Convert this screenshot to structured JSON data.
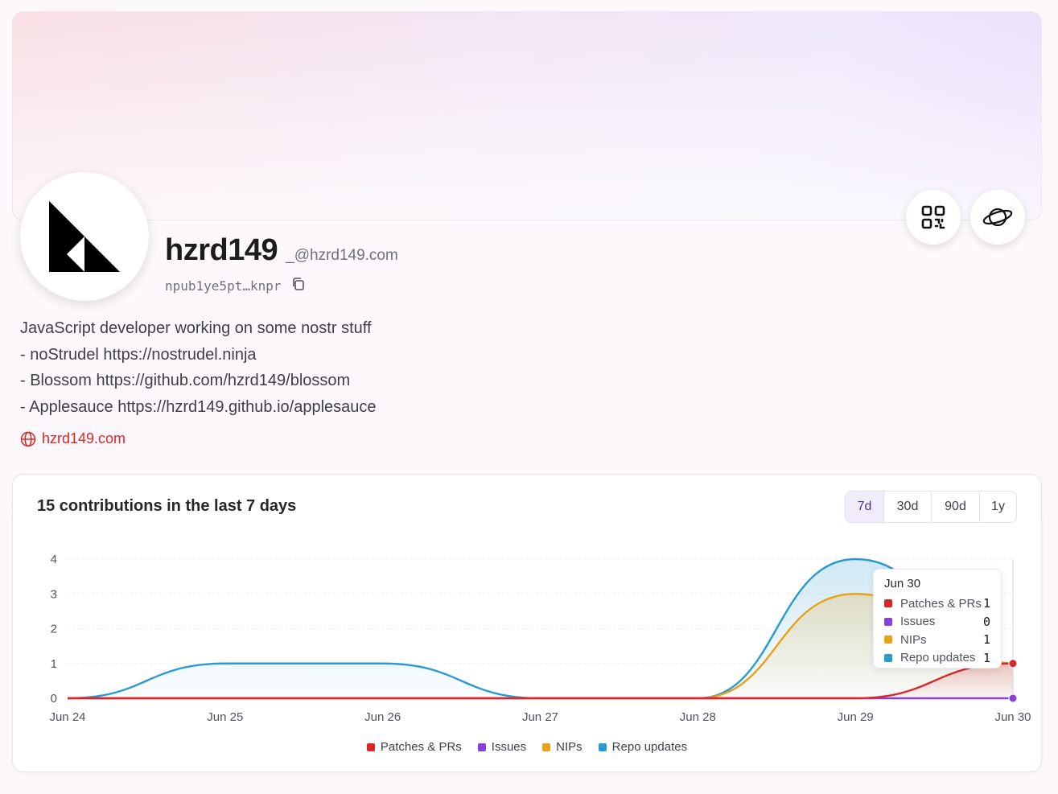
{
  "profile": {
    "name": "hzrd149",
    "nip05": "_@hzrd149.com",
    "npub": "npub1ye5pt…knpr",
    "bio": [
      "JavaScript developer working on some nostr stuff",
      "- noStrudel https://nostrudel.ninja",
      "- Blossom https://github.com/hzrd149/blossom",
      "- Applesauce https://hzrd149.github.io/applesauce"
    ],
    "website": "hzrd149.com"
  },
  "icons": {
    "copy": "copy-icon",
    "qr": "qr-code-icon",
    "planet": "planet-icon",
    "globe": "globe-icon"
  },
  "contributions": {
    "title": "15 contributions in the last 7 days",
    "ranges": [
      "7d",
      "30d",
      "90d",
      "1y"
    ],
    "active_range": "7d"
  },
  "colors": {
    "patches": "#dc2626",
    "issues": "#8b3fd9",
    "nips": "#e8a21a",
    "repo_updates": "#2b9ad0",
    "accent": "#dc2626"
  },
  "tooltip": {
    "title": "Jun 30",
    "rows": [
      {
        "label": "Patches & PRs",
        "value": "1"
      },
      {
        "label": "Issues",
        "value": "0"
      },
      {
        "label": "NIPs",
        "value": "1"
      },
      {
        "label": "Repo updates",
        "value": "1"
      }
    ]
  },
  "chart_data": {
    "type": "area",
    "categories": [
      "Jun 24",
      "Jun 25",
      "Jun 26",
      "Jun 27",
      "Jun 28",
      "Jun 29",
      "Jun 30"
    ],
    "series": [
      {
        "name": "Patches & PRs",
        "values": [
          0,
          0,
          0,
          0,
          0,
          0,
          1
        ]
      },
      {
        "name": "Issues",
        "values": [
          0,
          0,
          0,
          0,
          0,
          0,
          0
        ]
      },
      {
        "name": "NIPs",
        "values": [
          0,
          0,
          0,
          0,
          0,
          3,
          1
        ]
      },
      {
        "name": "Repo updates",
        "values": [
          0,
          1,
          1,
          0,
          0,
          4,
          1
        ]
      }
    ],
    "yticks": [
      0,
      1,
      2,
      3,
      4
    ],
    "ylim": [
      0,
      4
    ],
    "legend": "bottom",
    "grid": true
  }
}
